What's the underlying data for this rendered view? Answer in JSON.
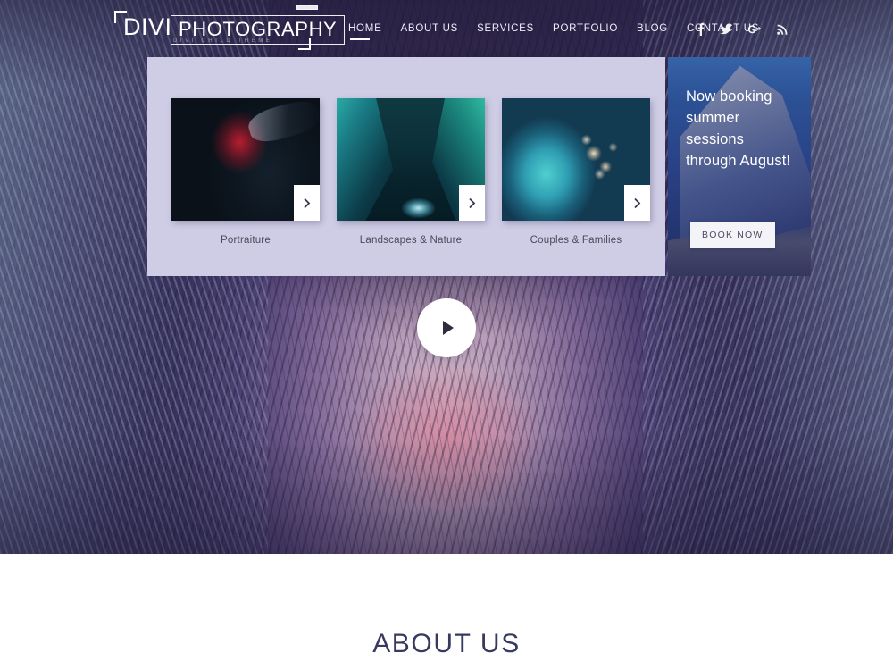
{
  "header": {
    "logo": {
      "primary": "DIVI",
      "secondary": "PHOTOGRAPHY",
      "subtitle": "DIVI CHILD THEME"
    },
    "nav": [
      {
        "label": "HOME",
        "active": true
      },
      {
        "label": "ABOUT US",
        "active": false
      },
      {
        "label": "SERVICES",
        "active": false
      },
      {
        "label": "PORTFOLIO",
        "active": false
      },
      {
        "label": "BLOG",
        "active": false
      },
      {
        "label": "CONTACT US",
        "active": false
      }
    ],
    "social": [
      {
        "name": "facebook-icon",
        "glyph": "f"
      },
      {
        "name": "twitter-icon",
        "glyph": "twitter"
      },
      {
        "name": "google-plus-icon",
        "glyph": "G+"
      },
      {
        "name": "rss-icon",
        "glyph": "rss"
      }
    ]
  },
  "slider": {
    "cards": [
      {
        "caption": "Portraiture",
        "arrow": "chevron-right-icon"
      },
      {
        "caption": "Landscapes & Nature",
        "arrow": "chevron-right-icon"
      },
      {
        "caption": "Couples & Families",
        "arrow": "chevron-right-icon"
      }
    ]
  },
  "booking": {
    "headline": "Now booking summer sessions through August!",
    "button_label": "BOOK NOW"
  },
  "hero": {
    "play_button": "play-icon"
  },
  "about": {
    "title": "ABOUT US"
  },
  "colors": {
    "panel_bg": "#cfcde6",
    "accent_navy": "#373a5e",
    "hero_purple": "#4b3f73",
    "booking_blue": "#2d4f96",
    "white": "#ffffff"
  }
}
